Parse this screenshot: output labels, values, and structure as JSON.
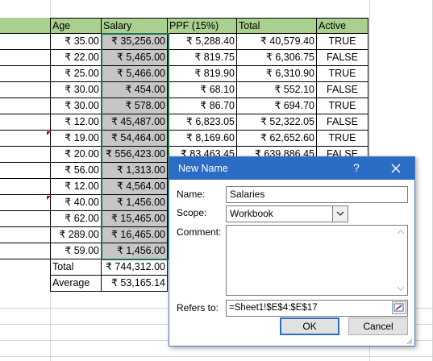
{
  "columns": [
    "Age",
    "Salary",
    "PPF (15%)",
    "Total",
    "Active"
  ],
  "rows": [
    {
      "age": "₹ 35.00",
      "salary": "₹ 35,256.00",
      "ppf": "₹ 5,288.40",
      "total": "₹ 40,579.40",
      "active": "TRUE"
    },
    {
      "age": "₹ 22.00",
      "salary": "₹ 5,465.00",
      "ppf": "₹ 819.75",
      "total": "₹ 6,306.75",
      "active": "FALSE"
    },
    {
      "age": "₹ 25.00",
      "salary": "₹ 5,466.00",
      "ppf": "₹ 819.90",
      "total": "₹ 6,310.90",
      "active": "TRUE"
    },
    {
      "age": "₹ 30.00",
      "salary": "₹ 454.00",
      "ppf": "₹ 68.10",
      "total": "₹ 552.10",
      "active": "FALSE"
    },
    {
      "age": "₹ 30.00",
      "salary": "₹ 578.00",
      "ppf": "₹ 86.70",
      "total": "₹ 694.70",
      "active": "TRUE"
    },
    {
      "age": "₹ 12.00",
      "salary": "₹ 45,487.00",
      "ppf": "₹ 6,823.05",
      "total": "₹ 52,322.05",
      "active": "FALSE"
    },
    {
      "age": "₹ 19.00",
      "salary": "₹ 54,464.00",
      "ppf": "₹ 8,169.60",
      "total": "₹ 62,652.60",
      "active": "TRUE"
    },
    {
      "age": "₹ 20.00",
      "salary": "₹ 556,423.00",
      "ppf": "₹ 83,463.45",
      "total": "₹ 639,886.45",
      "active": "FALSE"
    },
    {
      "age": "₹ 56.00",
      "salary": "₹ 1,313.00",
      "ppf": "",
      "total": "",
      "active": ""
    },
    {
      "age": "₹ 12.00",
      "salary": "₹ 4,564.00",
      "ppf": "",
      "total": "",
      "active": ""
    },
    {
      "age": "₹ 40.00",
      "salary": "₹ 1,456.00",
      "ppf": "",
      "total": "",
      "active": ""
    },
    {
      "age": "₹ 62.00",
      "salary": "₹ 15,465.00",
      "ppf": "",
      "total": "",
      "active": ""
    },
    {
      "age": "₹ 289.00",
      "salary": "₹ 16,465.00",
      "ppf": "",
      "total": "",
      "active": ""
    },
    {
      "age": "₹ 59.00",
      "salary": "₹ 1,456.00",
      "ppf": "",
      "total": "",
      "active": ""
    }
  ],
  "summary": [
    {
      "label": "Total",
      "value": "₹ 744,312.00"
    },
    {
      "label": "Average",
      "value": "₹ 53,165.14"
    }
  ],
  "dialog": {
    "title": "New Name",
    "help": "?",
    "close_icon": "close-icon",
    "name_label": "Name:",
    "name_value": "Salaries",
    "scope_label": "Scope:",
    "scope_value": "Workbook",
    "comment_label": "Comment:",
    "comment_value": "",
    "refers_label": "Refers to:",
    "refers_value": "=Sheet1!$E$4:$E$17",
    "ok_label": "OK",
    "cancel_label": "Cancel"
  },
  "colors": {
    "header_fill": "#a9d08e",
    "selection_fill": "#c6c6c6",
    "title_bar": "#2b6cc4",
    "comment_marker": "#c00000"
  }
}
